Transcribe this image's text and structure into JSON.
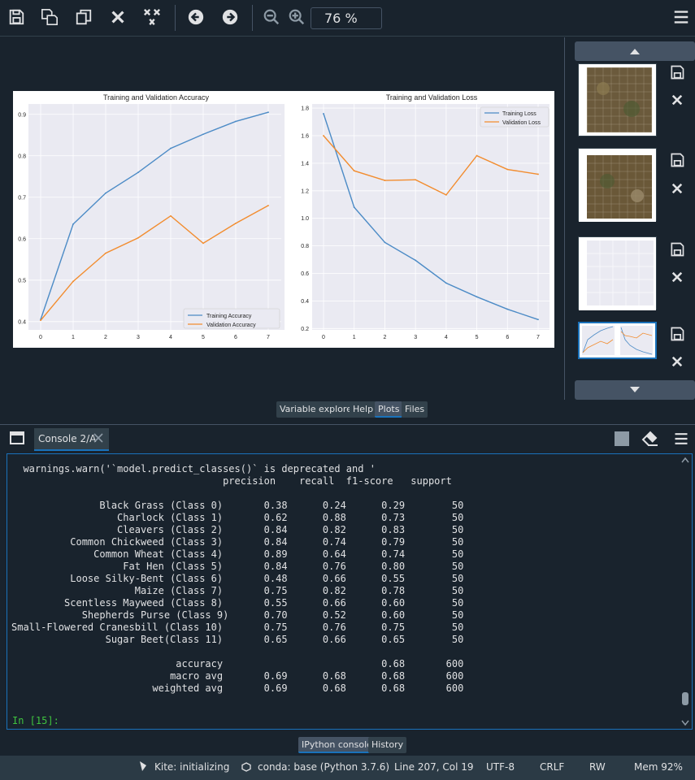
{
  "toolbar": {
    "icons": [
      "save-icon",
      "save-all-icon",
      "copy-icon",
      "close-icon",
      "close-all-icon",
      "back-arrow-icon",
      "forward-arrow-icon",
      "zoom-out-icon",
      "zoom-in-icon",
      "hamburger-menu-icon"
    ],
    "zoom_value": "76 %"
  },
  "plot": {
    "left_chart": {
      "title": "Training and Validation Accuracy",
      "legend": [
        "Training Accuracy",
        "Validation Accuracy"
      ]
    },
    "right_chart": {
      "title": "Training and Validation Loss",
      "legend": [
        "Training Loss",
        "Validation Loss"
      ]
    }
  },
  "chart_data": [
    {
      "type": "line",
      "title": "Training and Validation Accuracy",
      "x": [
        0,
        1,
        2,
        3,
        4,
        5,
        6,
        7
      ],
      "xticks": [
        "0",
        "1",
        "2",
        "3",
        "4",
        "5",
        "6",
        "7"
      ],
      "yticks": [
        "0.4",
        "0.5",
        "0.6",
        "0.7",
        "0.8",
        "0.9"
      ],
      "ylim": [
        0.38,
        0.925
      ],
      "legend_position": "lower-right",
      "grid": true,
      "series": [
        {
          "name": "Training Accuracy",
          "color": "#4c8bc6",
          "values": [
            0.405,
            0.635,
            0.71,
            0.76,
            0.818,
            0.852,
            0.883,
            0.905
          ]
        },
        {
          "name": "Validation Accuracy",
          "color": "#f28c2e",
          "values": [
            0.403,
            0.497,
            0.565,
            0.602,
            0.655,
            0.589,
            0.637,
            0.68
          ]
        }
      ]
    },
    {
      "type": "line",
      "title": "Training and Validation Loss",
      "x": [
        0,
        1,
        2,
        3,
        4,
        5,
        6,
        7
      ],
      "xticks": [
        "0",
        "1",
        "2",
        "3",
        "4",
        "5",
        "6",
        "7"
      ],
      "yticks": [
        "0.2",
        "0.4",
        "0.6",
        "0.8",
        "1.0",
        "1.2",
        "1.4",
        "1.6",
        "1.8"
      ],
      "ylim": [
        0.19,
        1.83
      ],
      "legend_position": "upper-right",
      "grid": true,
      "series": [
        {
          "name": "Training Loss",
          "color": "#4c8bc6",
          "values": [
            1.76,
            1.08,
            0.825,
            0.695,
            0.53,
            0.43,
            0.34,
            0.265
          ]
        },
        {
          "name": "Validation Loss",
          "color": "#f28c2e",
          "values": [
            1.6,
            1.345,
            1.275,
            1.28,
            1.17,
            1.455,
            1.355,
            1.32
          ]
        }
      ]
    }
  ],
  "pane_tabs": [
    "Variable explorer",
    "Help",
    "Plots",
    "Files"
  ],
  "console": {
    "tab_label": "Console 2/A",
    "lines": [
      "",
      "  warnings.warn('`model.predict_classes()` is deprecated and '",
      "                                    precision    recall  f1-score   support",
      "",
      "               Black Grass (Class 0)       0.38      0.24      0.29        50",
      "                  Charlock (Class 1)       0.62      0.88      0.73        50",
      "                  Cleavers (Class 2)       0.84      0.82      0.83        50",
      "          Common Chickweed (Class 3)       0.84      0.74      0.79        50",
      "              Common Wheat (Class 4)       0.89      0.64      0.74        50",
      "                   Fat Hen (Class 5)       0.84      0.76      0.80        50",
      "          Loose Silky-Bent (Class 6)       0.48      0.66      0.55        50",
      "                     Maize (Class 7)       0.75      0.82      0.78        50",
      "         Scentless Mayweed (Class 8)       0.55      0.66      0.60        50",
      "            Shepherds Purse (Class 9)      0.70      0.52      0.60        50",
      "Small-Flowered Cranesbill (Class 10)       0.75      0.76      0.75        50",
      "                Sugar Beet(Class 11)       0.65      0.66      0.65        50",
      "",
      "                            accuracy                           0.68       600",
      "                           macro avg       0.69      0.68      0.68       600",
      "                        weighted avg       0.69      0.68      0.68       600"
    ],
    "prompt": "In [15]:"
  },
  "console_tabs": [
    "IPython console",
    "History"
  ],
  "status": {
    "kite": "Kite: initializing",
    "conda": "conda: base (Python 3.7.6)",
    "position": "Line 207, Col 19",
    "encoding": "UTF-8",
    "eol": "CRLF",
    "rw": "RW",
    "mem": "Mem 92%"
  }
}
